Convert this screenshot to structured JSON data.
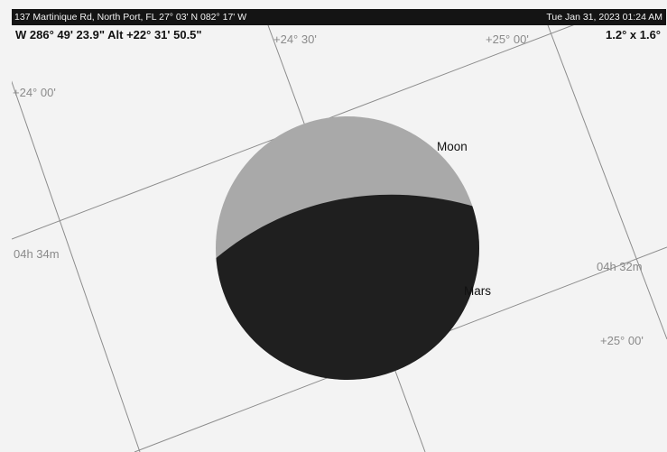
{
  "topbar": {
    "location": "137 Martinique Rd, North Port, FL  27° 03' N 082° 17' W",
    "datetime": "Tue Jan 31, 2023  01:24 AM"
  },
  "infobar": {
    "position": "W 286° 49' 23.9\" Alt +22° 31' 50.5\"",
    "field_of_view": "1.2° x 1.6°"
  },
  "grid_labels": {
    "dec_24_30": "+24° 30'",
    "dec_25_00_top": "+25° 00'",
    "dec_24_00": "+24° 00'",
    "ra_04h34m": "04h 34m",
    "ra_04h32m": "04h 32m",
    "dec_25_00_right": "+25° 00'"
  },
  "objects": {
    "moon": {
      "label": "Moon"
    },
    "mars": {
      "label": "Mars"
    }
  },
  "colors": {
    "sky_background": "#f3f3f3",
    "grid_line": "#8a8a8a",
    "grid_label": "#8a8a8a",
    "moon_lit": "#a9a9a9",
    "moon_dark": "#1f1f1f",
    "topbar_bg": "#141414"
  }
}
